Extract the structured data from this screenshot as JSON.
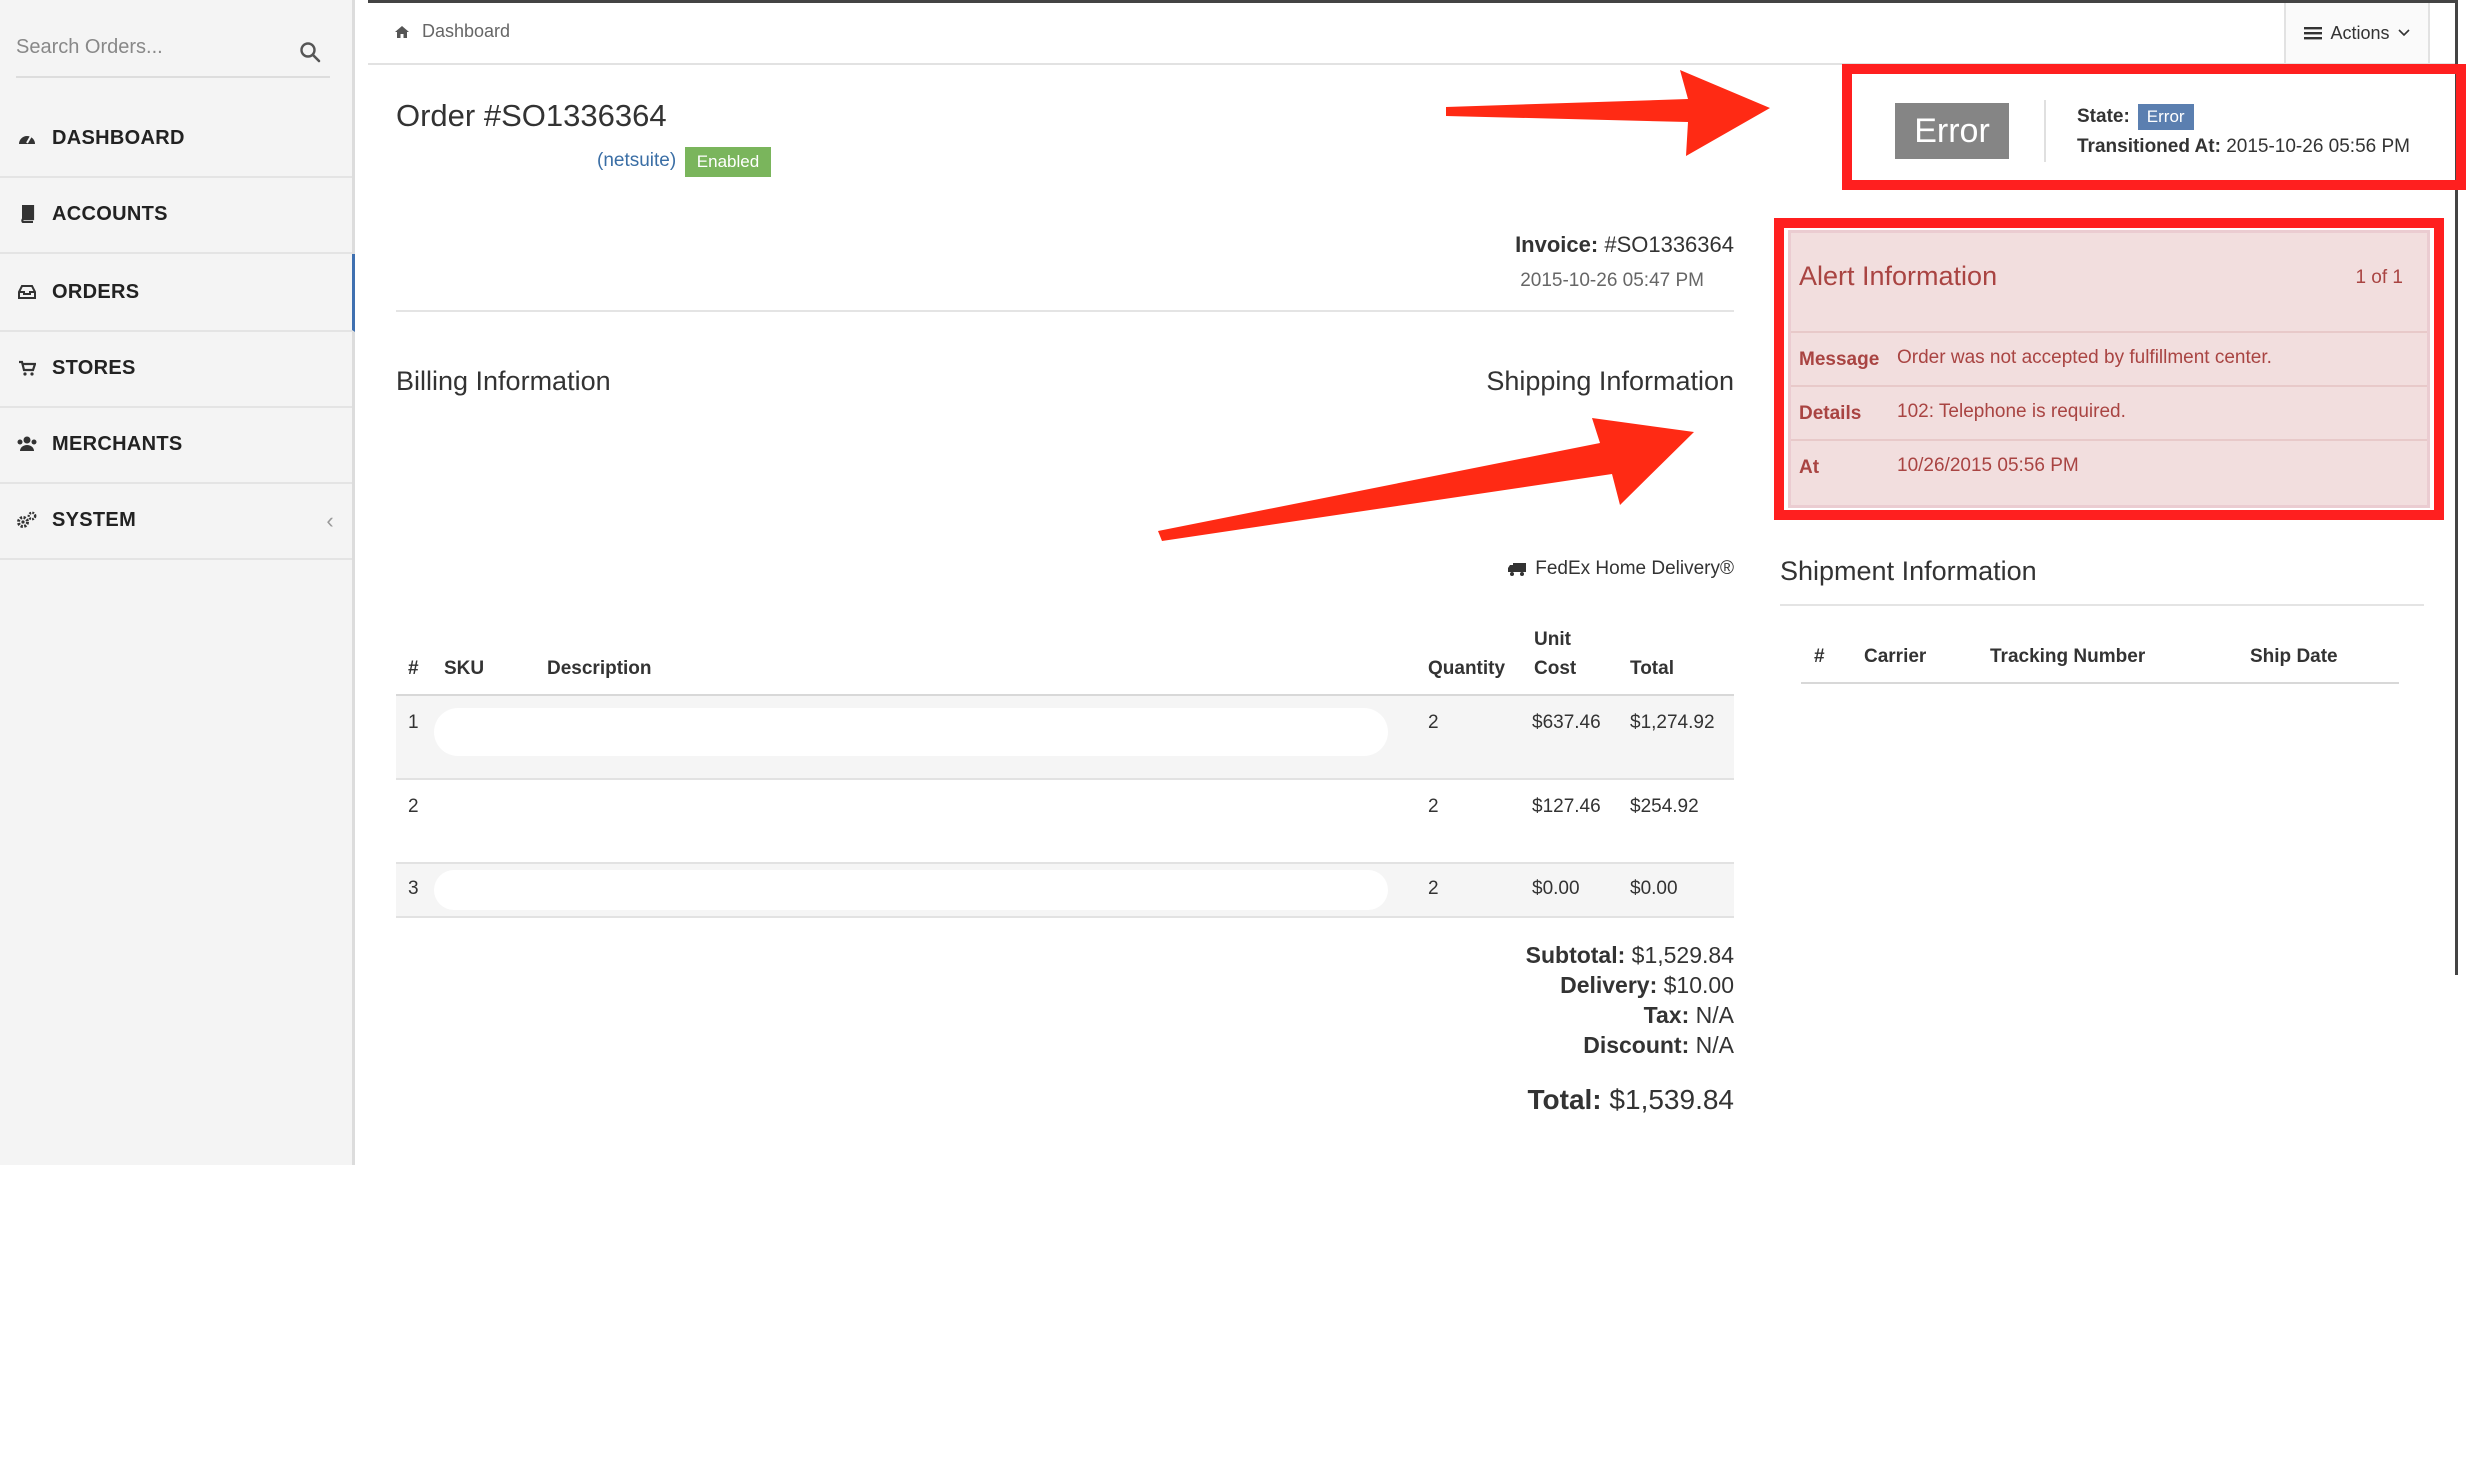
{
  "search": {
    "placeholder": "Search Orders..."
  },
  "sidebar": {
    "items": [
      {
        "label": "DASHBOARD",
        "icon": "dashboard-icon"
      },
      {
        "label": "ACCOUNTS",
        "icon": "book-icon"
      },
      {
        "label": "ORDERS",
        "icon": "inbox-icon",
        "active": true
      },
      {
        "label": "STORES",
        "icon": "cart-icon"
      },
      {
        "label": "MERCHANTS",
        "icon": "users-icon"
      },
      {
        "label": "SYSTEM",
        "icon": "gears-icon",
        "has_chevron": true
      }
    ]
  },
  "header": {
    "breadcrumb": "Dashboard",
    "actions_label": "Actions"
  },
  "order": {
    "title": "Order #SO1336364",
    "source": "(netsuite)",
    "status_badge": "Enabled",
    "invoice_label": "Invoice:",
    "invoice_number": "#SO1336364",
    "invoice_date": "2015-10-26 05:47 PM",
    "billing_title": "Billing Information",
    "shipping_title": "Shipping Information",
    "shipping_method": "FedEx Home Delivery®"
  },
  "items_table": {
    "headers": {
      "num": "#",
      "sku": "SKU",
      "description": "Description",
      "quantity": "Quantity",
      "unit_cost_1": "Unit",
      "unit_cost_2": "Cost",
      "total": "Total"
    },
    "rows": [
      {
        "num": "1",
        "sku": "",
        "description": "",
        "quantity": "2",
        "unit_cost": "$637.46",
        "total": "$1,274.92"
      },
      {
        "num": "2",
        "sku": "",
        "description": "",
        "quantity": "2",
        "unit_cost": "$127.46",
        "total": "$254.92"
      },
      {
        "num": "3",
        "sku": "",
        "description": "",
        "quantity": "2",
        "unit_cost": "$0.00",
        "total": "$0.00"
      }
    ]
  },
  "totals": {
    "subtotal_label": "Subtotal:",
    "subtotal": "$1,529.84",
    "delivery_label": "Delivery:",
    "delivery": "$10.00",
    "tax_label": "Tax:",
    "tax": "N/A",
    "discount_label": "Discount:",
    "discount": "N/A",
    "total_label": "Total:",
    "total": "$1,539.84"
  },
  "state_panel": {
    "big_label": "Error",
    "state_label": "State:",
    "state_value": "Error",
    "transitioned_label": "Transitioned At:",
    "transitioned_value": "2015-10-26 05:56 PM"
  },
  "alert": {
    "title": "Alert Information",
    "count": "1 of 1",
    "rows": [
      {
        "key": "Message",
        "value": "Order was not accepted by fulfillment center."
      },
      {
        "key": "Details",
        "value": "102: Telephone is required."
      },
      {
        "key": "At",
        "value": "10/26/2015 05:56 PM"
      }
    ]
  },
  "shipment": {
    "title": "Shipment Information",
    "headers": {
      "num": "#",
      "carrier": "Carrier",
      "tracking": "Tracking Number",
      "ship_date": "Ship Date"
    }
  },
  "colors": {
    "annotation_red": "#ff1f1f",
    "alert_bg": "#f2dede",
    "alert_text": "#a94442",
    "enabled_green": "#7ab55c",
    "state_blue": "#5b7fb0",
    "error_gray": "#858585"
  }
}
